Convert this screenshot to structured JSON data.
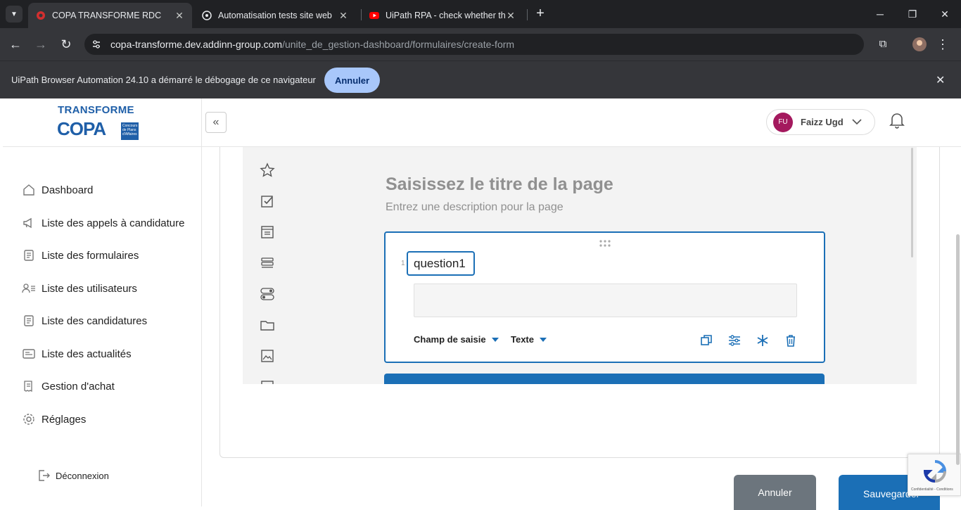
{
  "browser": {
    "tabs": [
      {
        "title": "COPA TRANSFORME RDC",
        "active": true
      },
      {
        "title": "Automatisation tests site web",
        "active": false
      },
      {
        "title": "UiPath RPA - check whether the",
        "active": false
      }
    ],
    "url_host": "copa-transforme.dev.addinn-group.com",
    "url_path": "/unite_de_gestion-dashboard/formulaires/create-form",
    "infobar_message": "UiPath Browser Automation 24.10 a démarré le débogage de ce navigateur",
    "infobar_cancel": "Annuler"
  },
  "logo": {
    "line1": "TRANSFORME",
    "line2": "COPA",
    "box": "Concours de Plans d'Affaires"
  },
  "sidebar": {
    "items": [
      {
        "label": "Dashboard",
        "icon": "home-icon"
      },
      {
        "label": "Liste des appels à candidature",
        "icon": "megaphone-icon"
      },
      {
        "label": "Liste des formulaires",
        "icon": "form-icon"
      },
      {
        "label": "Liste des utilisateurs",
        "icon": "users-icon"
      },
      {
        "label": "Liste des candidatures",
        "icon": "document-icon"
      },
      {
        "label": "Liste des actualités",
        "icon": "news-icon"
      },
      {
        "label": "Gestion d'achat",
        "icon": "receipt-icon"
      },
      {
        "label": "Réglages",
        "icon": "gear-icon"
      }
    ],
    "logout": "Déconnexion"
  },
  "header": {
    "user_initials": "FU",
    "user_name": "Faizz Ugd"
  },
  "designer": {
    "page_title_placeholder": "Saisissez le titre de la page",
    "page_desc_placeholder": "Entrez une description pour la page",
    "question": {
      "number": "1",
      "title": "question1",
      "type_label": "Champ de saisie",
      "input_type_label": "Texte"
    }
  },
  "actions": {
    "cancel": "Annuler",
    "save": "Sauvegarder"
  },
  "recaptcha": {
    "text": "Confidentialité - Conditions"
  },
  "colors": {
    "primary": "#1b6fb6",
    "avatar": "#a4195e",
    "cancel_btn": "#6c757d"
  }
}
